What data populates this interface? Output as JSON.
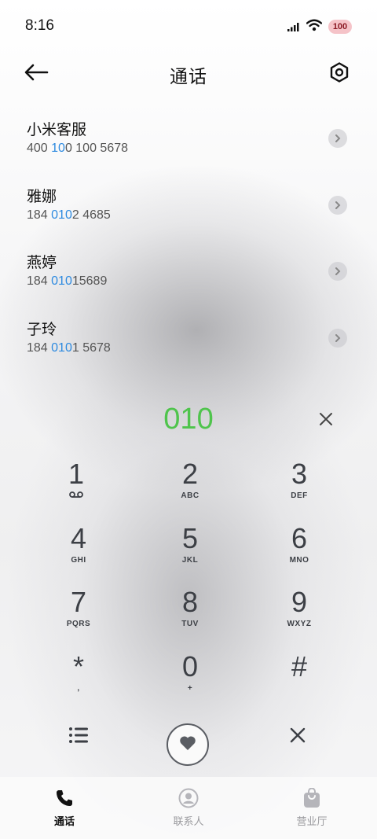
{
  "status": {
    "time": "8:16",
    "battery": "100"
  },
  "header": {
    "title": "通话"
  },
  "results": [
    {
      "name": "小米客服",
      "number_pre": "400 ",
      "number_hl": "10",
      "number_post": "0 100 5678"
    },
    {
      "name": "雅娜",
      "number_pre": "184 ",
      "number_hl": "010",
      "number_post": "2 4685"
    },
    {
      "name": "燕婷",
      "number_pre": "184 ",
      "number_hl": "010",
      "number_post": "15689"
    },
    {
      "name": "子玲",
      "number_pre": "184 ",
      "number_hl": "010",
      "number_post": "1 5678"
    }
  ],
  "dialer": {
    "input": "010",
    "keys": [
      {
        "digit": "1",
        "letters": ""
      },
      {
        "digit": "2",
        "letters": "ABC"
      },
      {
        "digit": "3",
        "letters": "DEF"
      },
      {
        "digit": "4",
        "letters": "GHI"
      },
      {
        "digit": "5",
        "letters": "JKL"
      },
      {
        "digit": "6",
        "letters": "MNO"
      },
      {
        "digit": "7",
        "letters": "PQRS"
      },
      {
        "digit": "8",
        "letters": "TUV"
      },
      {
        "digit": "9",
        "letters": "WXYZ"
      },
      {
        "digit": "*",
        "letters": ","
      },
      {
        "digit": "0",
        "letters": "+"
      },
      {
        "digit": "#",
        "letters": ""
      }
    ]
  },
  "tabs": [
    {
      "label": "通话",
      "icon": "phone-icon",
      "active": true
    },
    {
      "label": "联系人",
      "icon": "contact-icon",
      "active": false
    },
    {
      "label": "营业厅",
      "icon": "shopping-bag-icon",
      "active": false
    }
  ],
  "colors": {
    "accent": "#4fc44c",
    "highlight": "#2d8ae0"
  }
}
